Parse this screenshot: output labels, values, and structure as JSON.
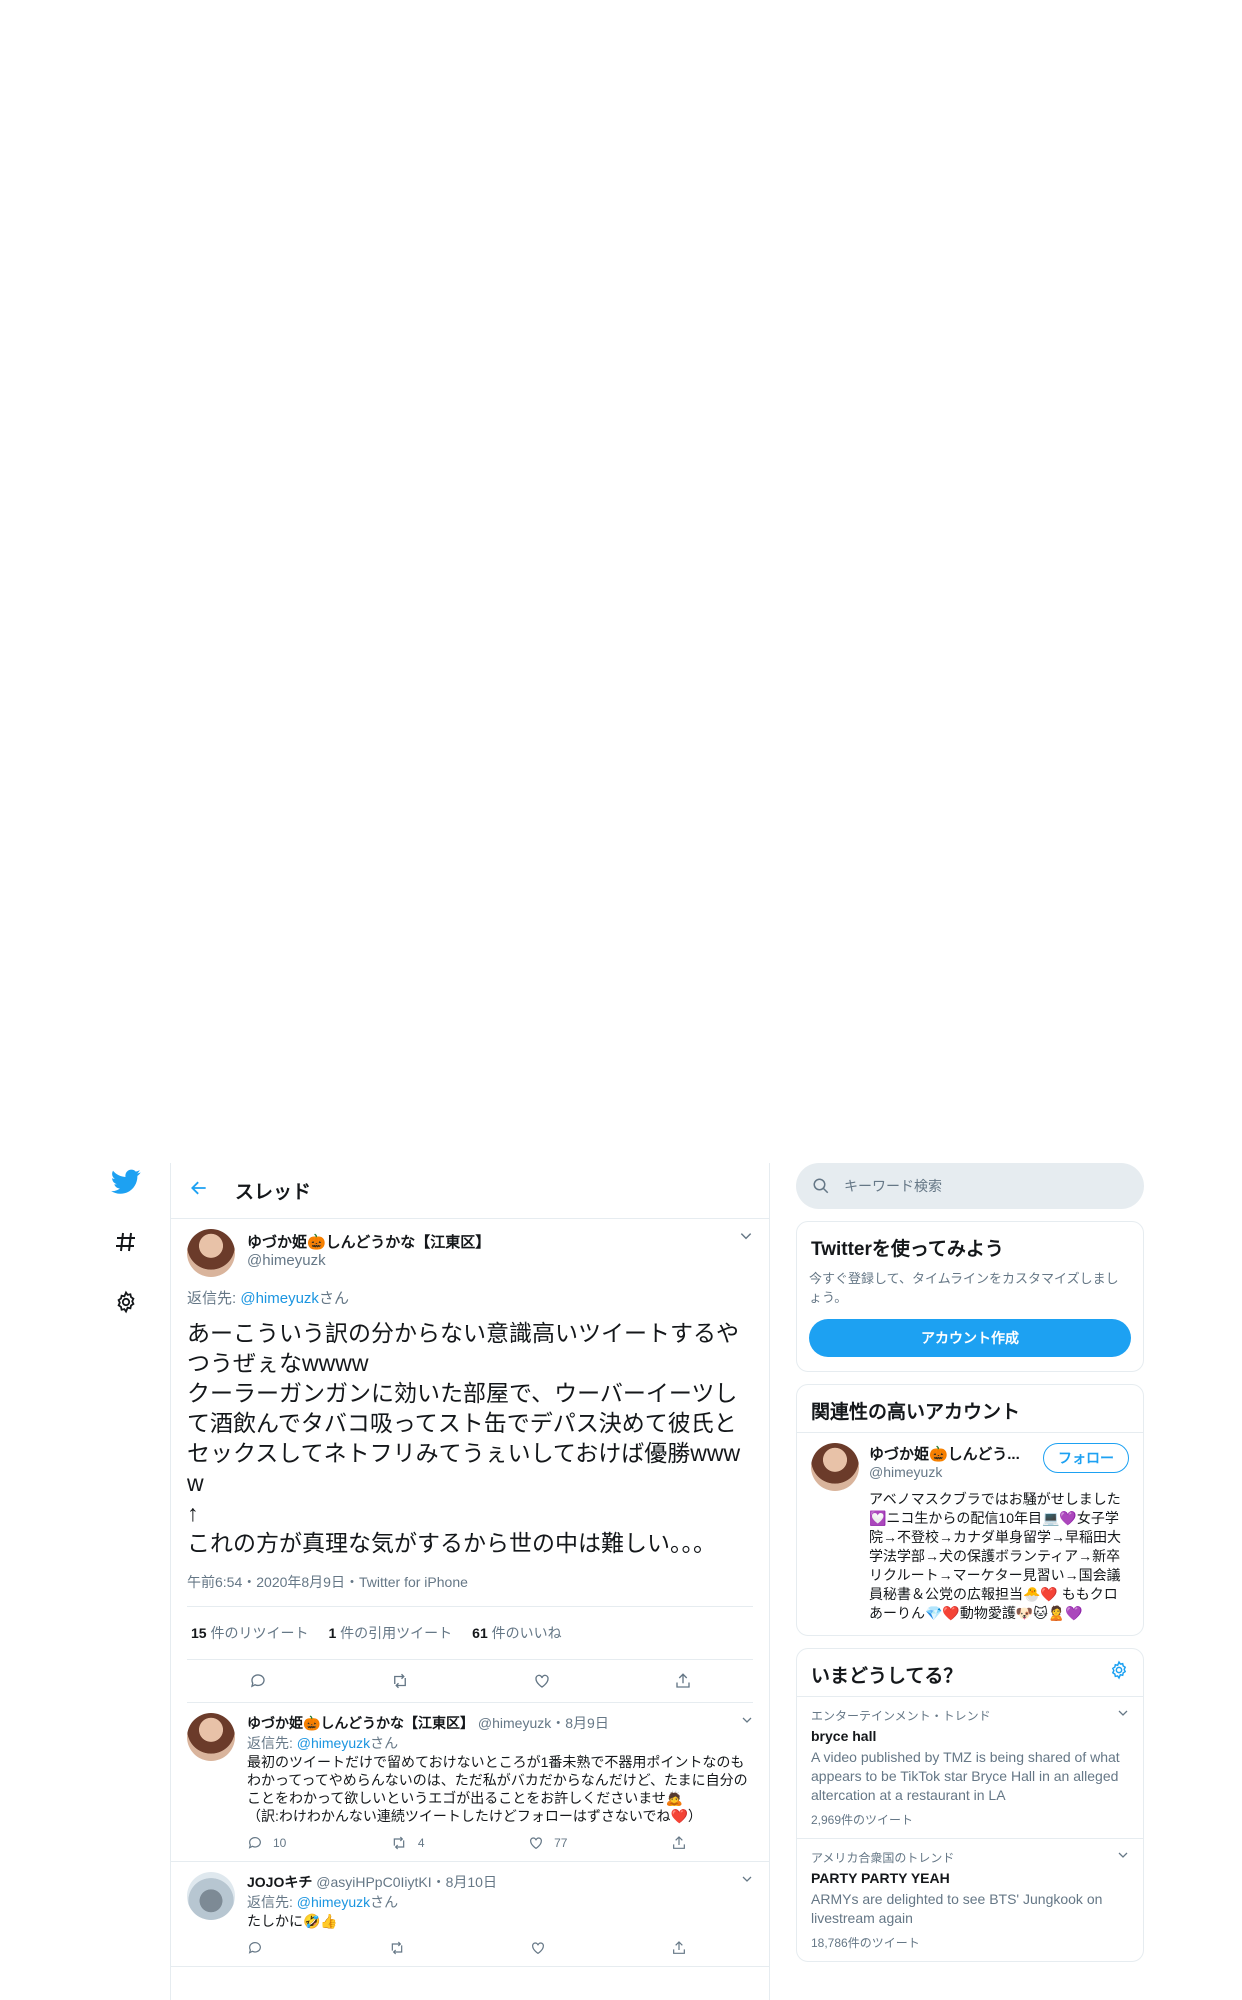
{
  "nav": {
    "twitter_logo": "twitter-bird-icon",
    "explore_icon": "hashtag-icon",
    "settings_icon": "gear-icon"
  },
  "header": {
    "title": "スレッド"
  },
  "main_tweet": {
    "display_name": "ゆづか姫🎃しんどうかな【江東区】",
    "handle": "@himeyuzk",
    "reply_to_prefix": "返信先: ",
    "reply_to_handle": "@himeyuzk",
    "reply_to_suffix": "さん",
    "text": "あーこういう訳の分からない意識高いツイートするやつうぜぇなwwww\nクーラーガンガンに効いた部屋で、ウーバーイーツして酒飲んでタバコ吸ってスト缶でデパス決めて彼氏とセックスしてネトフリみてうぇいしておけば優勝wwww\n↑\nこれの方が真理な気がするから世の中は難しい。。。",
    "meta": "午前6:54・2020年8月9日・Twitter for iPhone",
    "retweets": "15",
    "retweets_label": " 件のリツイート",
    "quotes": "1",
    "quotes_label": " 件の引用ツイート",
    "likes": "61",
    "likes_label": " 件のいいね"
  },
  "replies": [
    {
      "display_name": "ゆづか姫🎃しんどうかな【江東区】",
      "handle": "@himeyuzk・8月9日",
      "reply_prefix": "返信先: ",
      "reply_handle": "@himeyuzk",
      "reply_suffix": "さん",
      "text": "最初のツイートだけで留めておけないところが1番未熟で不器用ポイントなのもわかってってやめらんないのは、ただ私がバカだからなんだけど、たまに自分のことをわかって欲しいというエゴが出ることをお許しくださいませ🙇\n（訳:わけわかんない連続ツイートしたけどフォローはずさないでね❤️）",
      "replies": "10",
      "retweets": "4",
      "likes": "77"
    },
    {
      "display_name": "JOJOキチ",
      "handle": "@asyiHPpC0IiytKI・8月10日",
      "reply_prefix": "返信先: ",
      "reply_handle": "@himeyuzk",
      "reply_suffix": "さん",
      "text": "たしかに🤣👍",
      "replies": "",
      "retweets": "",
      "likes": ""
    }
  ],
  "sidebar": {
    "search_placeholder": "キーワード検索",
    "signup": {
      "title": "Twitterを使ってみよう",
      "sub": "今すぐ登録して、タイムラインをカスタマイズしましょう。",
      "button": "アカウント作成"
    },
    "related": {
      "title": "関連性の高いアカウント",
      "name": "ゆづか姫🎃しんどう...",
      "handle": "@himeyuzk",
      "follow": "フォロー",
      "bio": "アベノマスクブラではお騒がせしました💟ニコ生からの配信10年目💻💜女子学院→不登校→カナダ単身留学→早稲田大学法学部→犬の保護ボランティア→新卒リクルート→マーケター見習い→国会議員秘書＆公党の広報担当🐣❤️ ももクロあーりん💎❤️動物愛護🐶🐱🙎💜"
    },
    "trends": {
      "title": "いまどうしてる？",
      "items": [
        {
          "category": "エンターテインメント・トレンド",
          "name": "bryce hall",
          "desc": "A video published by TMZ is being shared of what appears to be TikTok star Bryce Hall in an alleged altercation at a restaurant in LA",
          "count": "2,969件のツイート"
        },
        {
          "category": "アメリカ合衆国のトレンド",
          "name": "PARTY PARTY YEAH",
          "desc": "ARMYs are delighted to see BTS' Jungkook on livestream again",
          "count": "18,786件のツイート"
        }
      ]
    }
  },
  "colors": {
    "accent": "#1da1f2",
    "border": "#e6ecf0",
    "muted": "#657786"
  }
}
